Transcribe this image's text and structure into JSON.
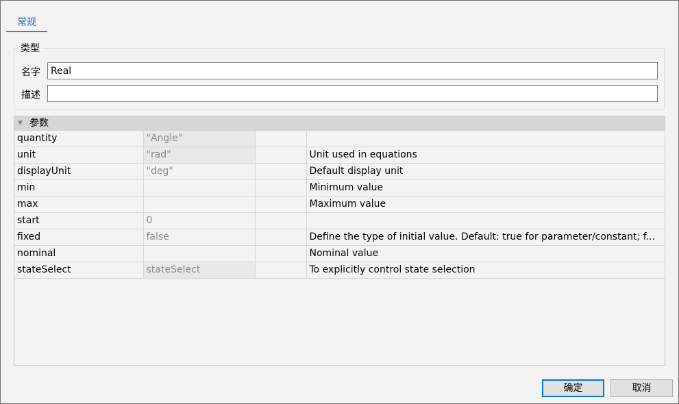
{
  "tabs": [
    {
      "label": "常规"
    }
  ],
  "type_group": {
    "title": "类型",
    "name_label": "名字",
    "name_value": "Real",
    "desc_label": "描述",
    "desc_value": ""
  },
  "parameters": {
    "title": "参数",
    "rows": [
      {
        "name": "quantity",
        "value": "\"Angle\"",
        "unit": "",
        "desc": ""
      },
      {
        "name": "unit",
        "value": "\"rad\"",
        "unit": "",
        "desc": "Unit used in equations"
      },
      {
        "name": "displayUnit",
        "value": "\"deg\"",
        "unit": "",
        "desc": "Default display unit"
      },
      {
        "name": "min",
        "value": "",
        "unit": "",
        "desc": "Minimum value"
      },
      {
        "name": "max",
        "value": "",
        "unit": "",
        "desc": "Maximum value"
      },
      {
        "name": "start",
        "value": "0",
        "unit": "",
        "desc": ""
      },
      {
        "name": "fixed",
        "value": "false",
        "unit": "",
        "desc": "Define the type of initial value. Default: true for parameter/constant; f..."
      },
      {
        "name": "nominal",
        "value": "",
        "unit": "",
        "desc": "Nominal value"
      },
      {
        "name": "stateSelect",
        "value": "stateSelect",
        "unit": "",
        "desc": "To explicitly control state selection"
      }
    ]
  },
  "buttons": {
    "ok": "确定",
    "cancel": "取消"
  }
}
